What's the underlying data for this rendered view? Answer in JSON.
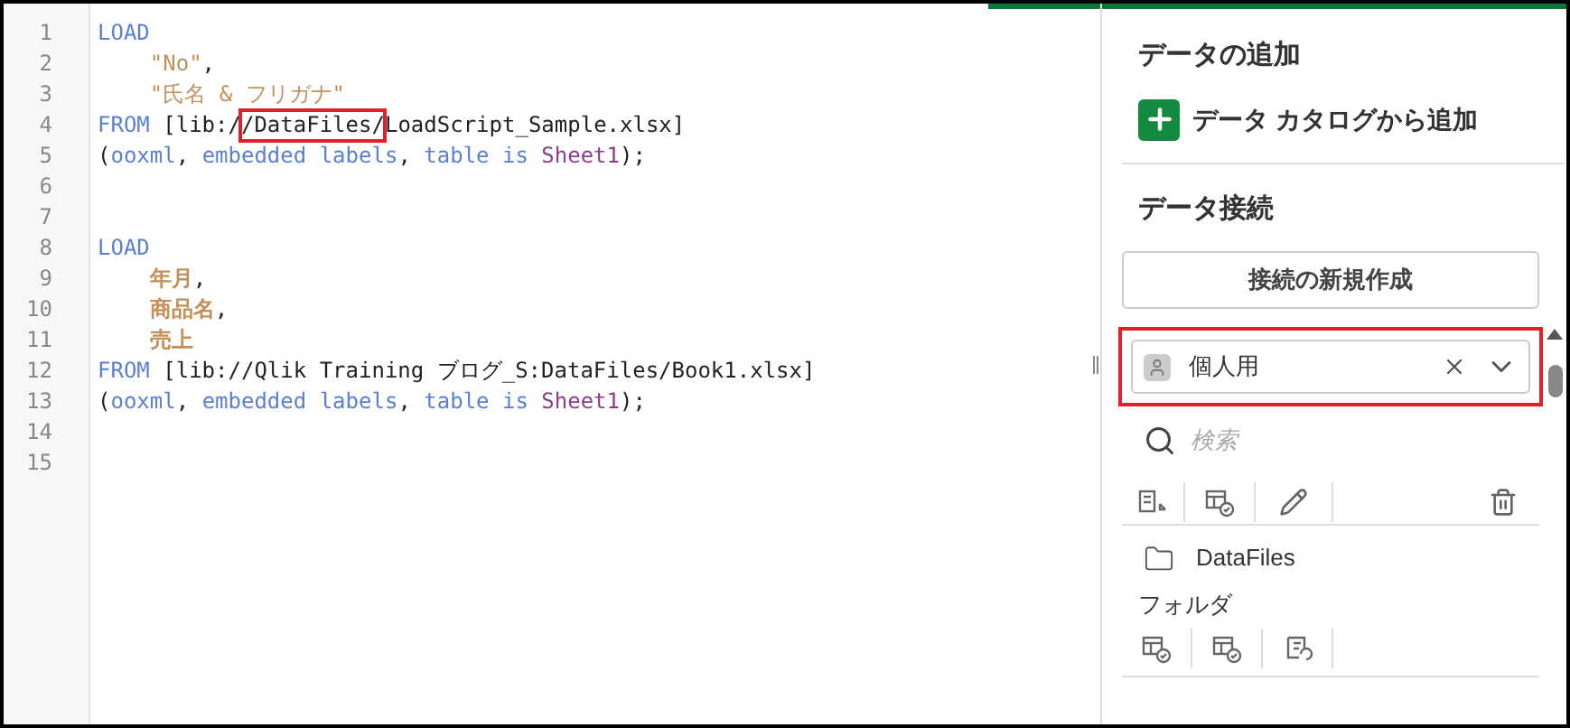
{
  "progress": {
    "level": 0.37
  },
  "editor": {
    "lines": [
      {
        "number": "1",
        "tokens": [
          {
            "kind": "keyword",
            "text": "LOAD"
          }
        ]
      },
      {
        "number": "2",
        "indent": true,
        "tokens": [
          {
            "kind": "string",
            "text": "\"No\""
          },
          {
            "kind": "plain",
            "text": ","
          }
        ]
      },
      {
        "number": "3",
        "indent": true,
        "tokens": [
          {
            "kind": "string",
            "text": "\"氏名 & フリガナ\""
          }
        ]
      },
      {
        "number": "4",
        "tokens": [
          {
            "kind": "keyword",
            "text": "FROM"
          },
          {
            "kind": "plain",
            "text": "[lib:/",
            "space_before": true
          },
          {
            "kind": "plain",
            "text": "/DataFiles/",
            "highlighted": true
          },
          {
            "kind": "plain",
            "text": "LoadScript_Sample.xlsx]"
          }
        ]
      },
      {
        "number": "5",
        "tokens": [
          {
            "kind": "plain",
            "text": "("
          },
          {
            "kind": "keyword",
            "text": "ooxml"
          },
          {
            "kind": "plain",
            "text": ","
          },
          {
            "kind": "keyword",
            "text": "embedded labels",
            "space_before": true
          },
          {
            "kind": "plain",
            "text": ","
          },
          {
            "kind": "keyword",
            "text": "table is",
            "space_before": true
          },
          {
            "kind": "sheet",
            "text": "Sheet1",
            "space_before": true
          },
          {
            "kind": "plain",
            "text": ");"
          }
        ]
      },
      {
        "number": "6"
      },
      {
        "number": "7"
      },
      {
        "number": "8",
        "tokens": [
          {
            "kind": "keyword",
            "text": "LOAD"
          }
        ]
      },
      {
        "number": "9",
        "indent": true,
        "tokens": [
          {
            "kind": "field",
            "text": "年月"
          },
          {
            "kind": "plain",
            "text": ","
          }
        ]
      },
      {
        "number": "10",
        "indent": true,
        "tokens": [
          {
            "kind": "field",
            "text": "商品名"
          },
          {
            "kind": "plain",
            "text": ","
          }
        ]
      },
      {
        "number": "11",
        "indent": true,
        "tokens": [
          {
            "kind": "field",
            "text": "売上"
          }
        ]
      },
      {
        "number": "12",
        "tokens": [
          {
            "kind": "keyword",
            "text": "FROM"
          },
          {
            "kind": "plain",
            "text": "[lib://Qlik Training ブログ_S:DataFiles/Book1.xlsx]",
            "space_before": true
          }
        ]
      },
      {
        "number": "13",
        "tokens": [
          {
            "kind": "plain",
            "text": "("
          },
          {
            "kind": "keyword",
            "text": "ooxml"
          },
          {
            "kind": "plain",
            "text": ","
          },
          {
            "kind": "keyword",
            "text": "embedded labels",
            "space_before": true
          },
          {
            "kind": "plain",
            "text": ","
          },
          {
            "kind": "keyword",
            "text": "table is",
            "space_before": true
          },
          {
            "kind": "sheet",
            "text": "Sheet1",
            "space_before": true
          },
          {
            "kind": "plain",
            "text": ");"
          }
        ]
      },
      {
        "number": "14"
      },
      {
        "number": "15"
      }
    ]
  },
  "panel": {
    "add_data_title": "データの追加",
    "add_from_catalog": "データ カタログから追加",
    "connections_title": "データ接続",
    "new_connection_button": "接続の新規作成",
    "space_select": {
      "value": "個人用",
      "highlighted": true
    },
    "search": {
      "placeholder": "検索"
    },
    "connection": {
      "name": "DataFiles",
      "type": "フォルダ"
    }
  }
}
